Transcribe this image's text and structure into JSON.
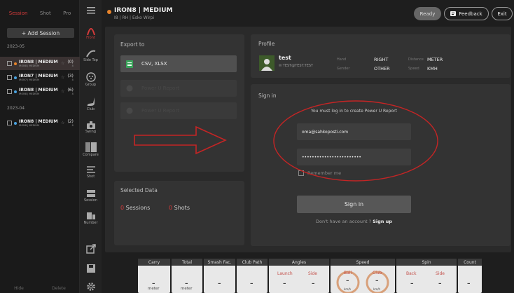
{
  "left": {
    "tabs": [
      "Session",
      "Shot",
      "Pro"
    ],
    "add_session": "+ Add Session",
    "groups": [
      {
        "date": "2023-05",
        "sessions": [
          {
            "title": "IRON8 | MEDIUM",
            "sub": "IRON8 | MEDIUM",
            "count": "(0)",
            "count_sub": "8",
            "selected": true
          },
          {
            "title": "IRON7 | MEDIUM",
            "sub": "IRON7 | MEDIUM",
            "count": "(3)",
            "count_sub": "8",
            "selected": false
          },
          {
            "title": "IRON8 | MEDIUM",
            "sub": "IRON8 | MEDIUM",
            "count": "(6)",
            "count_sub": "8",
            "selected": false
          }
        ]
      },
      {
        "date": "2023-04",
        "sessions": [
          {
            "title": "IRON8 | MEDIUM",
            "sub": "IRON8 | MEDIUM",
            "count": "(2)",
            "count_sub": "8",
            "selected": false
          }
        ]
      }
    ],
    "footer": [
      "Hide",
      "Delete"
    ]
  },
  "rail": [
    {
      "label": "Front",
      "icon": "front-icon",
      "active": true
    },
    {
      "label": "Side Top",
      "icon": "side-top-icon",
      "active": false
    },
    {
      "label": "Group",
      "icon": "group-icon",
      "active": false
    },
    {
      "label": "Club",
      "icon": "club-icon",
      "active": false
    },
    {
      "label": "Swing",
      "icon": "swing-icon",
      "active": false
    },
    {
      "label": "Compare",
      "icon": "compare-icon",
      "active": false
    },
    {
      "label": "Shot",
      "icon": "shot-icon",
      "active": false
    },
    {
      "label": "Session",
      "icon": "session-icon",
      "active": false
    },
    {
      "label": "Number",
      "icon": "number-icon",
      "active": false
    }
  ],
  "header": {
    "title": "IRON8 | MEDIUM",
    "sub": "I8 | RH | Esko Wirpi",
    "ready": "Ready",
    "feedback": "Feedback",
    "exit": "Exit"
  },
  "export": {
    "title": "Export to",
    "csv": "CSV, XLSX",
    "option2": "Power U Report",
    "option3": "Power U Report"
  },
  "selected": {
    "title": "Selected Data",
    "sessions_n": "0",
    "sessions_label": "Sessions",
    "shots_n": "0",
    "shots_label": "Shots"
  },
  "profile": {
    "title": "Profile",
    "name": "test",
    "email": "TEST@TEST.TEST",
    "hand_label": "Hand",
    "hand": "RIGHT",
    "gender_label": "Gender",
    "gender": "OTHER",
    "distance_label": "Distance",
    "distance": "METER",
    "speed_label": "Speed",
    "speed": "KMH"
  },
  "signin": {
    "title": "Sign in",
    "notice": "You must log in to create Power U Report",
    "email": "oma@sahkoposti.com",
    "password": "••••••••••••••••••••••••",
    "remember": "Remember me",
    "button": "Sign in",
    "no_account": "Don't have an account ?",
    "signup": "Sign up"
  },
  "metrics": {
    "carry": {
      "label": "Carry",
      "value": "–",
      "unit": "meter"
    },
    "total": {
      "label": "Total",
      "value": "–",
      "unit": "meter"
    },
    "smash": {
      "label": "Smash Fac.",
      "value": "–"
    },
    "clubpath": {
      "label": "Club Path",
      "value": "–"
    },
    "angles": {
      "label": "Angles",
      "sub1": "Launch",
      "sub2": "Side",
      "v1": "–",
      "v2": "–"
    },
    "speed": {
      "label": "Speed",
      "sub1": "Ball",
      "sub2": "Club",
      "v1": "–",
      "v2": "–",
      "u1": "km/h",
      "u2": "km/h"
    },
    "spin": {
      "label": "Spin",
      "sub1": "Back",
      "sub2": "Side",
      "v1": "–",
      "v2": "–"
    },
    "count": {
      "label": "Count",
      "value": "–"
    }
  },
  "colors": {
    "accent": "#d53a3a",
    "session_dot": "#e7842b",
    "annotation": "#c42525"
  }
}
